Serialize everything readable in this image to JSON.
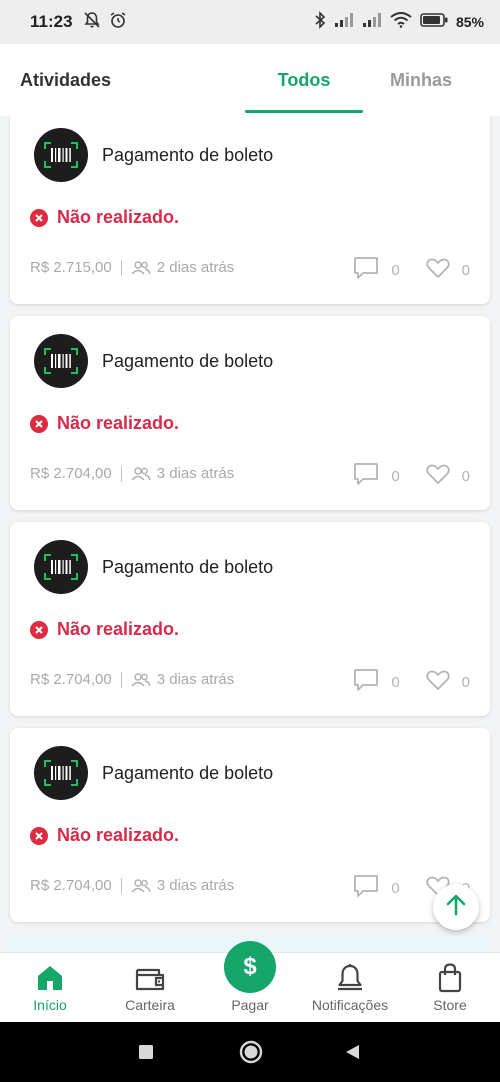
{
  "status_bar": {
    "time": "11:23",
    "battery": "85%",
    "icons": [
      "notifications-off-icon",
      "alarm-icon",
      "bluetooth-icon",
      "signal-icon",
      "signal-icon",
      "wifi-icon",
      "battery-icon"
    ]
  },
  "header": {
    "title": "Atividades",
    "tabs": [
      {
        "label": "Todos",
        "active": true
      },
      {
        "label": "Minhas",
        "active": false
      }
    ],
    "accent_color": "#16a56a"
  },
  "feed": {
    "items": [
      {
        "title": "Pagamento de boleto",
        "status": "Não realizado.",
        "amount": "R$ 2.715,00",
        "time": "2 dias atrás",
        "comments": "0",
        "likes": "0"
      },
      {
        "title": "Pagamento de boleto",
        "status": "Não realizado.",
        "amount": "R$ 2.704,00",
        "time": "3 dias atrás",
        "comments": "0",
        "likes": "0"
      },
      {
        "title": "Pagamento de boleto",
        "status": "Não realizado.",
        "amount": "R$ 2.704,00",
        "time": "3 dias atrás",
        "comments": "0",
        "likes": "0"
      },
      {
        "title": "Pagamento de boleto",
        "status": "Não realizado.",
        "amount": "R$ 2.704,00",
        "time": "3 dias atrás",
        "comments": "0",
        "likes": "0"
      }
    ],
    "status_color": "#d62b4b"
  },
  "bottom_nav": {
    "items": [
      {
        "label": "Início",
        "icon": "home-icon",
        "active": true
      },
      {
        "label": "Carteira",
        "icon": "wallet-icon",
        "active": false
      },
      {
        "label": "Pagar",
        "icon": "dollar-icon",
        "active": false
      },
      {
        "label": "Notificações",
        "icon": "bell-icon",
        "active": false
      },
      {
        "label": "Store",
        "icon": "shopping-bag-icon",
        "active": false
      }
    ],
    "pay_symbol": "$"
  },
  "system_nav": {
    "icons": [
      "recents-icon",
      "home-circle-icon",
      "back-icon"
    ]
  }
}
